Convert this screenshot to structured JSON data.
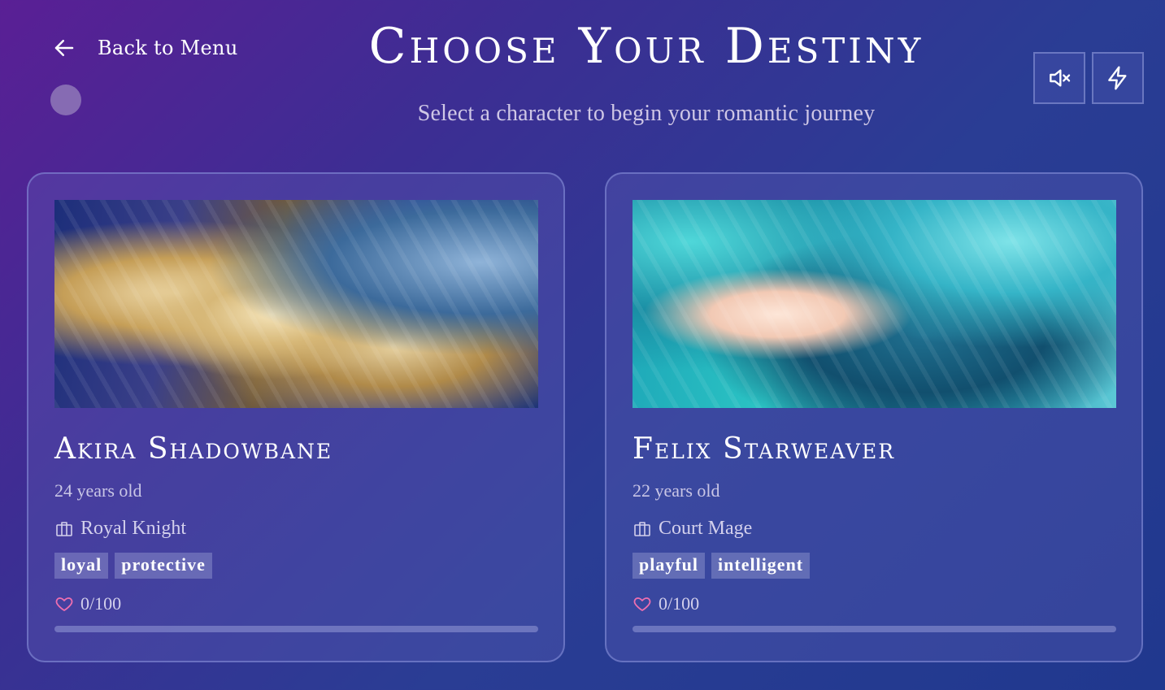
{
  "header": {
    "back_label": "Back to Menu",
    "title": "Choose Your Destiny",
    "subtitle": "Select a character to begin your romantic journey",
    "mute_icon": "volume-mute-icon",
    "bolt_icon": "lightning-bolt-icon"
  },
  "characters": [
    {
      "name": "Akira Shadowbane",
      "age": "24 years old",
      "role": "Royal Knight",
      "tags": [
        "loyal",
        "protective"
      ],
      "affection": "0/100",
      "affection_fraction": 0,
      "portrait": "knight-portrait"
    },
    {
      "name": "Felix Starweaver",
      "age": "22 years old",
      "role": "Court Mage",
      "tags": [
        "playful",
        "intelligent"
      ],
      "affection": "0/100",
      "affection_fraction": 0,
      "portrait": "mage-portrait"
    }
  ],
  "colors": {
    "accent_heart": "#f06fb0",
    "background_start": "#5a1f95",
    "background_end": "#20388e"
  }
}
